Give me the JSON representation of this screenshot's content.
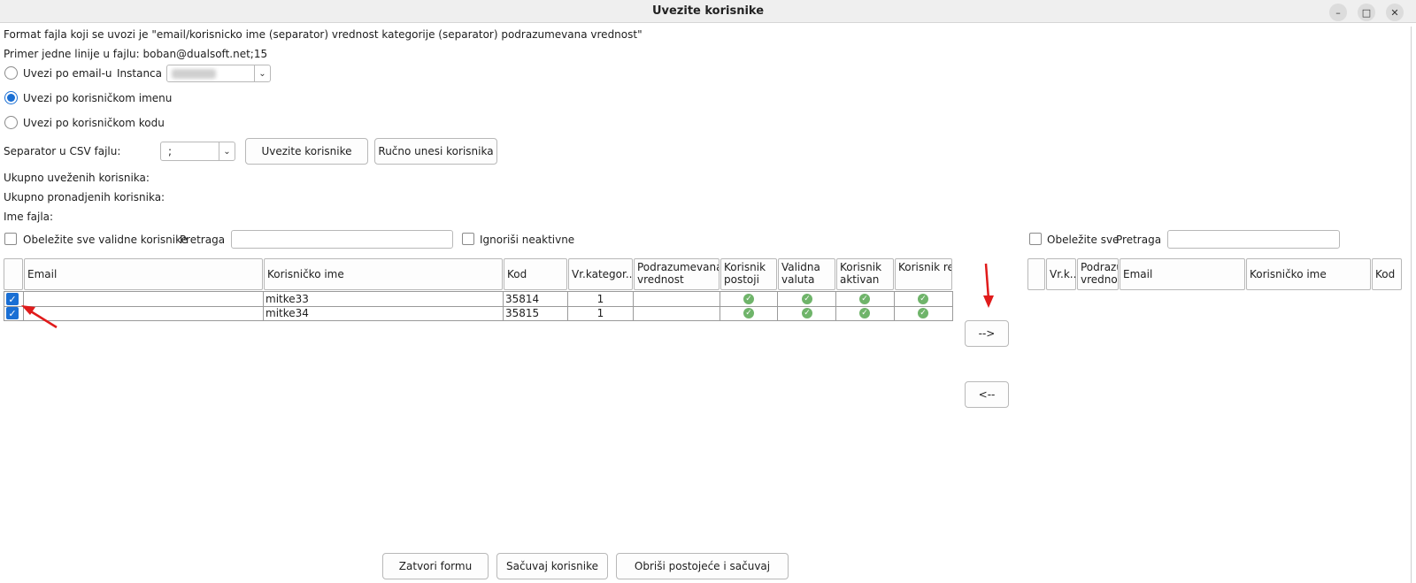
{
  "window": {
    "title": "Uvezite korisnike"
  },
  "info": {
    "format_line": "Format fajla koji se uvozi je \"email/korisnicko ime (separator) vrednost kategorije (separator) podrazumevana vrednost\"",
    "example_line": "Primer jedne linije u fajlu: boban@dualsoft.net;15"
  },
  "import_mode": {
    "by_email": "Uvezi po email-u",
    "by_username": "Uvezi po korisničkom imenu",
    "by_code": "Uvezi po korisničkom kodu",
    "selected": "by_username"
  },
  "instance": {
    "label": "Instanca"
  },
  "separator": {
    "label": "Separator u CSV fajlu:",
    "value": ";"
  },
  "toolbar": {
    "import_label": "Uvezite korisnike",
    "manual_label": "Ručno unesi korisnika"
  },
  "summary": {
    "imported_label": "Ukupno uveženih korisnika:",
    "found_label": "Ukupno pronadjenih korisnika:",
    "filename_label": "Ime fajla:"
  },
  "left_filter": {
    "mark_valid_label": "Obeležite sve validne korisnike",
    "search_label": "Pretraga",
    "search_value": "",
    "ignore_inactive_label": "Ignoriši neaktivne"
  },
  "left_table": {
    "headers": {
      "email": "Email",
      "username": "Korisničko ime",
      "code": "Kod",
      "category": "Vr.kategor...",
      "default_value": "Podrazumevana vrednost",
      "user_exists": "Korisnik postoji",
      "valid_currency": "Validna valuta",
      "user_active": "Korisnik aktivan",
      "user_registered": "Korisnik registrovan"
    },
    "rows": [
      {
        "checked": true,
        "email": "",
        "username": "mitke33",
        "code": "35814",
        "category": "1",
        "default_value": "",
        "exists": true,
        "valid": true,
        "active": true,
        "registered": true
      },
      {
        "checked": true,
        "email": "",
        "username": "mitke34",
        "code": "35815",
        "category": "1",
        "default_value": "",
        "exists": true,
        "valid": true,
        "active": true,
        "registered": true
      }
    ]
  },
  "transfer": {
    "move_right": "-->",
    "move_left": "<--"
  },
  "right_filter": {
    "mark_all_label": "Obeležite sve",
    "search_label": "Pretraga",
    "search_value": ""
  },
  "right_table": {
    "headers": {
      "category": "Vr.k...",
      "default_value": "Podrazumevana vrednost",
      "email": "Email",
      "username": "Korisničko ime",
      "code": "Kod"
    }
  },
  "footer": {
    "close_label": "Zatvori formu",
    "save_label": "Sačuvaj korisnike",
    "delete_save_label": "Obriši postojeće i sačuvaj"
  },
  "colors": {
    "accent": "#1a6fd4",
    "check_ok": "#6fb46a",
    "annotation_arrow": "#e01b1b"
  },
  "icons": {
    "minimize": "minimize-icon",
    "maximize": "maximize-icon",
    "close": "close-icon",
    "dropdown": "chevron-down-icon",
    "status_ok": "check-circle-icon",
    "annotation": "red-arrow-icon"
  }
}
